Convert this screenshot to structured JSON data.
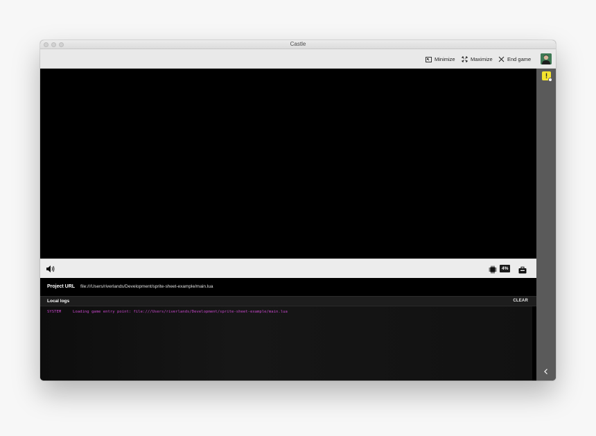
{
  "window": {
    "title": "Castle"
  },
  "toolbar": {
    "minimize_label": "Minimize",
    "maximize_label": "Maximize",
    "end_game_label": "End game"
  },
  "controls": {
    "fps_value": "4%"
  },
  "project": {
    "label": "Project URL",
    "url": "file:///Users/riverlands/Development/sprite-sheet-example/main.lua"
  },
  "logs": {
    "title": "Local logs",
    "clear_label": "CLEAR",
    "entries": [
      {
        "level": "SYSTEM",
        "message": "Loading game entry point: file:///Users/riverlands/Development/sprite-sheet-example/main.lua"
      }
    ]
  },
  "colors": {
    "log_system": "#c646c9",
    "badge_yellow": "#f5e32d",
    "sidebar": "#5a5a5a"
  }
}
